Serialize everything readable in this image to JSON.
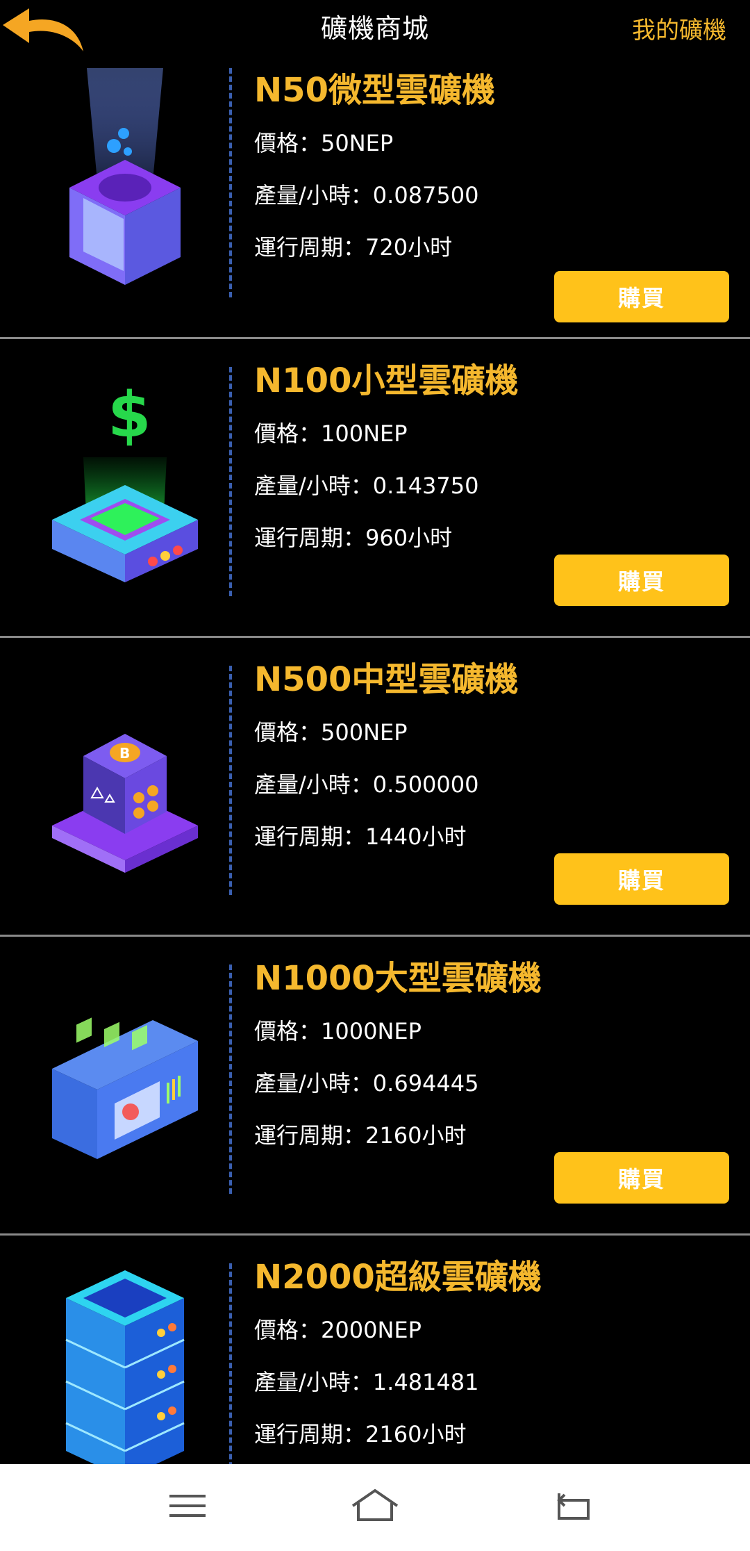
{
  "header": {
    "title": "礦機商城",
    "my_miners": "我的礦機"
  },
  "labels": {
    "price": "價格：",
    "output": "產量/小時：",
    "period": "運行周期："
  },
  "products": [
    {
      "name": "N50微型雲礦機",
      "price": "50NEP",
      "output": "0.087500",
      "period": "720小时",
      "buy": "購買"
    },
    {
      "name": "N100小型雲礦機",
      "price": "100NEP",
      "output": "0.143750",
      "period": "960小时",
      "buy": "購買"
    },
    {
      "name": "N500中型雲礦機",
      "price": "500NEP",
      "output": "0.500000",
      "period": "1440小时",
      "buy": "購買"
    },
    {
      "name": "N1000大型雲礦機",
      "price": "1000NEP",
      "output": "0.694445",
      "period": "2160小时",
      "buy": "購買"
    },
    {
      "name": "N2000超級雲礦機",
      "price": "2000NEP",
      "output": "1.481481",
      "period": "2160小时"
    }
  ],
  "colors": {
    "accent": "#f5b82e",
    "button": "#ffc21a",
    "background": "#000000",
    "divider": "#3a5fb0"
  },
  "icons": {
    "back": "back-arrow-icon",
    "menu": "menu-icon",
    "home": "home-icon",
    "return": "return-icon"
  }
}
